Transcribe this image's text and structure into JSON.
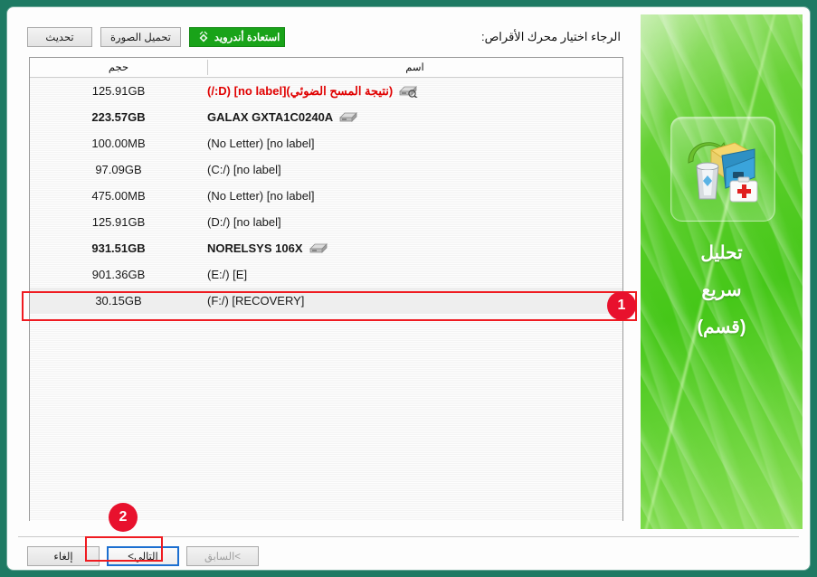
{
  "window": {
    "frame_color": "#1e7a63"
  },
  "toolbar": {
    "refresh_label": "تحديث",
    "load_image_label": "تحميل الصورة",
    "android_recovery_label": "استعادة أندرويد",
    "android_icon": "android-recovery-icon",
    "green_color": "#19a319"
  },
  "prompt": {
    "text": "الرجاء اختيار محرك الأقراص:"
  },
  "list": {
    "columns": {
      "size": "حجم",
      "name": "اسم"
    },
    "rows": [
      {
        "size": "125.91GB",
        "name": "(نتيجة المسح الضوئي)[no label] (D:/)",
        "icon": "disk-scan-icon",
        "style": "scan"
      },
      {
        "size": "223.57GB",
        "name": "GALAX GXTA1C0240A",
        "icon": "disk-icon",
        "style": "bold"
      },
      {
        "size": "100.00MB",
        "name": "(No Letter) [no label]",
        "icon": "",
        "style": "normal"
      },
      {
        "size": "97.09GB",
        "name": "(C:/) [no label]",
        "icon": "",
        "style": "normal"
      },
      {
        "size": "475.00MB",
        "name": "(No Letter) [no label]",
        "icon": "",
        "style": "normal"
      },
      {
        "size": "125.91GB",
        "name": "(D:/) [no label]",
        "icon": "",
        "style": "normal"
      },
      {
        "size": "931.51GB",
        "name": "NORELSYS 106X",
        "icon": "disk-icon",
        "style": "bold"
      },
      {
        "size": "901.36GB",
        "name": "(E:/) [E]",
        "icon": "",
        "style": "normal"
      },
      {
        "size": "30.15GB",
        "name": "(F:/) [RECOVERY]",
        "icon": "",
        "style": "selected"
      }
    ]
  },
  "buttons": {
    "cancel_label": "إلغاء",
    "next_label": "التالي>",
    "back_label": ">السابق"
  },
  "sidebar": {
    "icon": "recover-files-icon",
    "caption_line1": "تحليل",
    "caption_line2": "سريع",
    "caption_line3": "(قسم)"
  },
  "annotations": {
    "badge1": "1",
    "badge2": "2",
    "color": "#e8112d"
  }
}
